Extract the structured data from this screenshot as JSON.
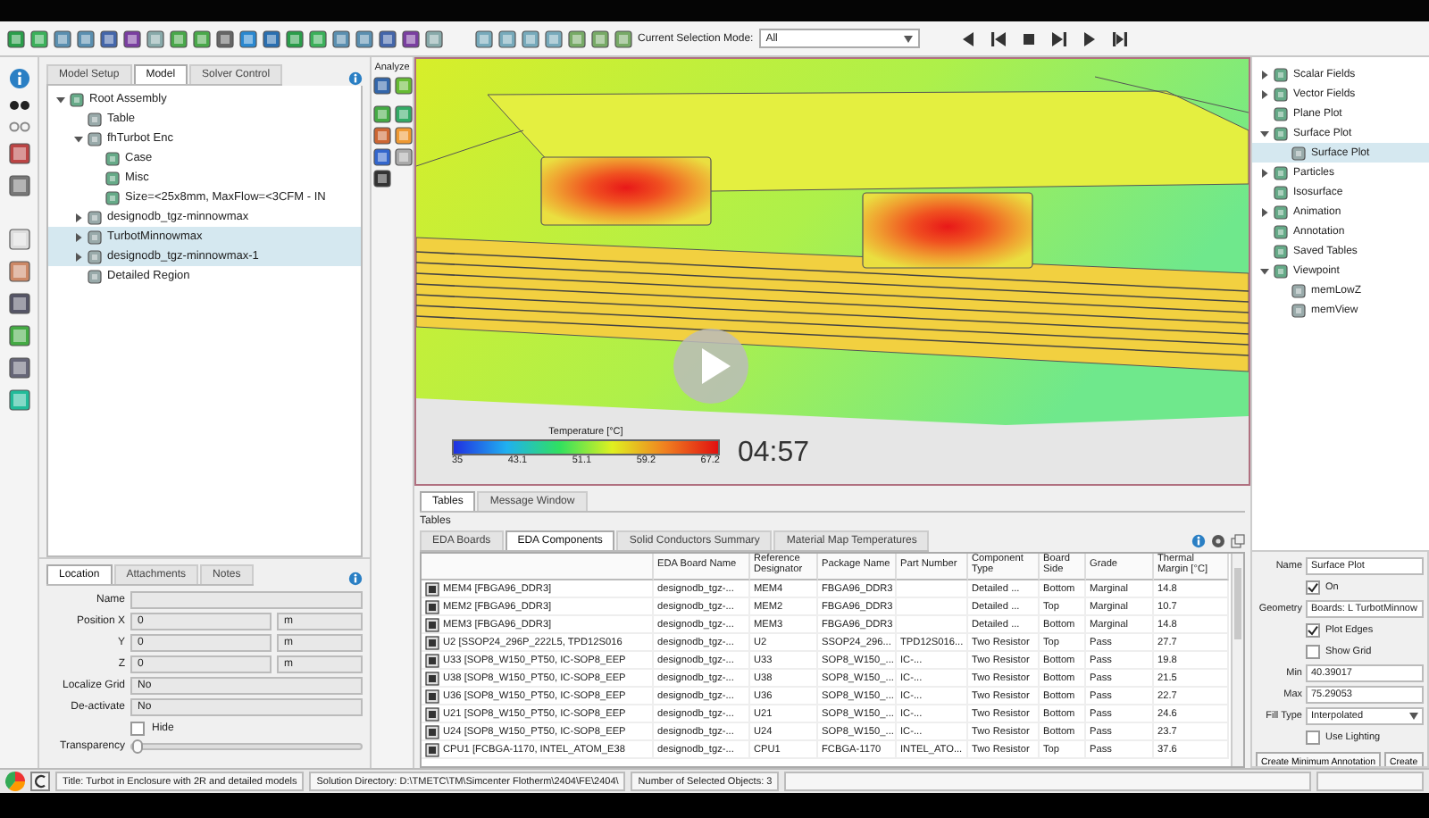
{
  "toolbar": {
    "selection_mode": {
      "label": "Current Selection Mode:",
      "value": "All"
    }
  },
  "model_tabs": [
    {
      "label": "Model Setup",
      "selected": false
    },
    {
      "label": "Model",
      "selected": true
    },
    {
      "label": "Solver Control",
      "selected": false
    }
  ],
  "model_tree": [
    {
      "label": "Root Assembly",
      "expanded": true,
      "selected": false,
      "children": [
        {
          "label": "Table",
          "selected": false
        },
        {
          "label": "fhTurbot Enc",
          "expanded": true,
          "selected": false,
          "children": [
            {
              "label": "Case",
              "selected": false
            },
            {
              "label": "Misc",
              "selected": false
            },
            {
              "label": "Size=<25x8mm, MaxFlow=<3CFM - IN",
              "selected": false
            }
          ]
        },
        {
          "label": "designodb_tgz-minnowmax",
          "expanded": false,
          "selected": false
        },
        {
          "label": "TurbotMinnowmax",
          "expanded": false,
          "selected": true
        },
        {
          "label": "designodb_tgz-minnowmax-1",
          "expanded": false,
          "selected": true
        },
        {
          "label": "Detailed Region",
          "selected": false
        }
      ]
    }
  ],
  "property_tabs": [
    {
      "label": "Location",
      "selected": true
    },
    {
      "label": "Attachments",
      "selected": false
    },
    {
      "label": "Notes",
      "selected": false
    }
  ],
  "properties": [
    {
      "kind": "field",
      "label": "Name"
    },
    {
      "kind": "field-unit",
      "label": "Position X",
      "value": "0",
      "unit": "m"
    },
    {
      "kind": "field-unit",
      "label": "Y",
      "value": "0",
      "unit": "m"
    },
    {
      "kind": "field-unit",
      "label": "Z",
      "value": "0",
      "unit": "m"
    },
    {
      "kind": "field",
      "label": "Localize Grid",
      "value": "No"
    },
    {
      "kind": "field",
      "label": "De-activate",
      "value": "No"
    },
    {
      "kind": "check",
      "label": "Hide",
      "checked": false
    },
    {
      "kind": "slider",
      "label": "Transparency",
      "level": 0
    }
  ],
  "analyze_label": "Analyze",
  "viewport": {
    "legend": {
      "title": "Temperature [°C]",
      "ticks": [
        "35",
        "43.1",
        "51.1",
        "59.2",
        "67.2"
      ]
    },
    "timestamp": "04:57"
  },
  "bottom_tabs": [
    {
      "label": "Tables",
      "selected": true
    },
    {
      "label": "Message Window",
      "selected": false
    }
  ],
  "tables_label": "Tables",
  "table_tabs": [
    {
      "label": "EDA Boards",
      "selected": false
    },
    {
      "label": "EDA Components",
      "selected": true
    },
    {
      "label": "Solid Conductors Summary",
      "selected": false
    },
    {
      "label": "Material Map Temperatures",
      "selected": false
    }
  ],
  "table": {
    "columns": [
      "",
      "EDA Board Name",
      "Reference Designator",
      "Package Name",
      "Part Number",
      "Component Type",
      "Board Side",
      "Grade",
      "Thermal Margin [°C]"
    ],
    "rows": [
      [
        "MEM4 [FBGA96_DDR3]",
        "designodb_tgz-...",
        "MEM4",
        "FBGA96_DDR3",
        "",
        "Detailed ...",
        "Bottom",
        "Marginal",
        "14.8"
      ],
      [
        "MEM2 [FBGA96_DDR3]",
        "designodb_tgz-...",
        "MEM2",
        "FBGA96_DDR3",
        "",
        "Detailed ...",
        "Top",
        "Marginal",
        "10.7"
      ],
      [
        "MEM3 [FBGA96_DDR3]",
        "designodb_tgz-...",
        "MEM3",
        "FBGA96_DDR3",
        "",
        "Detailed ...",
        "Bottom",
        "Marginal",
        "14.8"
      ],
      [
        "U2 [SSOP24_296P_222L5, TPD12S016",
        "designodb_tgz-...",
        "U2",
        "SSOP24_296...",
        "TPD12S016...",
        "Two Resistor",
        "Top",
        "Pass",
        "27.7"
      ],
      [
        "U33 [SOP8_W150_PT50, IC-SOP8_EEP",
        "designodb_tgz-...",
        "U33",
        "SOP8_W150_...",
        "IC-...",
        "Two Resistor",
        "Bottom",
        "Pass",
        "19.8"
      ],
      [
        "U38 [SOP8_W150_PT50, IC-SOP8_EEP",
        "designodb_tgz-...",
        "U38",
        "SOP8_W150_...",
        "IC-...",
        "Two Resistor",
        "Bottom",
        "Pass",
        "21.5"
      ],
      [
        "U36 [SOP8_W150_PT50, IC-SOP8_EEP",
        "designodb_tgz-...",
        "U36",
        "SOP8_W150_...",
        "IC-...",
        "Two Resistor",
        "Bottom",
        "Pass",
        "22.7"
      ],
      [
        "U21 [SOP8_W150_PT50, IC-SOP8_EEP",
        "designodb_tgz-...",
        "U21",
        "SOP8_W150_...",
        "IC-...",
        "Two Resistor",
        "Bottom",
        "Pass",
        "24.6"
      ],
      [
        "U24 [SOP8_W150_PT50, IC-SOP8_EEP",
        "designodb_tgz-...",
        "U24",
        "SOP8_W150_...",
        "IC-...",
        "Two Resistor",
        "Bottom",
        "Pass",
        "23.7"
      ],
      [
        "CPU1 [FCBGA-1170, INTEL_ATOM_E38",
        "designodb_tgz-...",
        "CPU1",
        "FCBGA-1170",
        "INTEL_ATO...",
        "Two Resistor",
        "Top",
        "Pass",
        "37.6"
      ]
    ]
  },
  "results_tree": [
    {
      "label": "Scalar Fields",
      "expanded": false,
      "selected": false
    },
    {
      "label": "Vector Fields",
      "expanded": false,
      "selected": false
    },
    {
      "label": "Plane Plot",
      "selected": false
    },
    {
      "label": "Surface Plot",
      "expanded": true,
      "selected": false,
      "children": [
        {
          "label": "Surface Plot",
          "selected": true
        }
      ]
    },
    {
      "label": "Particles",
      "expanded": false,
      "selected": false
    },
    {
      "label": "Isosurface",
      "selected": false
    },
    {
      "label": "Animation",
      "expanded": false,
      "selected": false
    },
    {
      "label": "Annotation",
      "selected": false
    },
    {
      "label": "Saved Tables",
      "selected": false
    },
    {
      "label": "Viewpoint",
      "expanded": true,
      "selected": false,
      "children": [
        {
          "label": "memLowZ",
          "selected": false
        },
        {
          "label": "memView",
          "selected": false
        }
      ]
    }
  ],
  "plot_properties": [
    {
      "kind": "field",
      "label": "Name",
      "value": "Surface Plot"
    },
    {
      "kind": "check",
      "label": "On",
      "checked": true
    },
    {
      "kind": "field",
      "label": "Geometry",
      "value": "Boards: L TurbotMinnow"
    },
    {
      "kind": "check",
      "label": "Plot Edges",
      "checked": true
    },
    {
      "kind": "check",
      "label": "Show Grid",
      "checked": false
    },
    {
      "kind": "field",
      "label": "Min",
      "value": "40.39017"
    },
    {
      "kind": "field",
      "label": "Max",
      "value": "75.29053"
    },
    {
      "kind": "combo",
      "label": "Fill Type",
      "value": "Interpolated"
    },
    {
      "kind": "check",
      "label": "Use Lighting",
      "checked": false
    }
  ],
  "plot_buttons": [
    "Create Minimum Annotation",
    "Create"
  ],
  "status_bar": {
    "title": "Title: Turbot in Enclosure with 2R and detailed models",
    "solution_directory": "Solution Directory: D:\\TMETC\\TM\\Simcenter Flotherm\\2404\\FE\\2404\\",
    "selected_objects": "Number of Selected Objects: 3"
  }
}
